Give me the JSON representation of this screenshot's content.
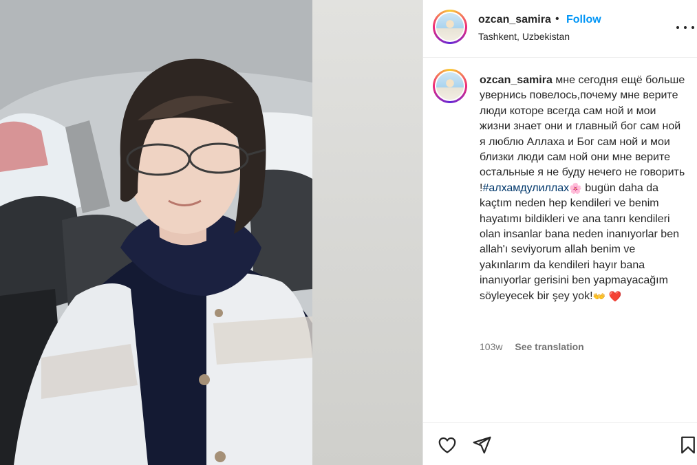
{
  "post": {
    "username": "ozcan_samira",
    "separator": "•",
    "follow_label": "Follow",
    "location": "Tashkent, Uzbekistan"
  },
  "caption": {
    "username": "ozcan_samira",
    "text_before_hashtag": "мне сегодня ещё больше увернись повелось,почему мне верите люди которе всегда сам ной и мои жизни знает они и главный бог сам ной я люблю Аллаха и Бог сам ной и мои близки люди сам ной они мне верите остальные я не буду нечего не говорить !",
    "hashtag": "#алхамдулиллах",
    "emoji_flower": "🌸",
    "text_after_hashtag": " bugün daha da kaçtım neden hep kendileri ve benim hayatımı bildikleri ve ana tanrı kendileri olan insanlar bana neden inanıyorlar ben allah'ı seviyorum allah benim ve yakınlarım da kendileri hayır bana inanıyorlar gerisini ben yapmayacağım söyleyecek bir şey yok!",
    "emoji_hands": "👐",
    "emoji_heart": "❤️"
  },
  "meta": {
    "time_ago": "103w",
    "see_translation_label": "See translation"
  },
  "icons": {
    "like": "heart-outline-icon",
    "share": "paper-plane-icon",
    "save": "bookmark-outline-icon",
    "more": "ellipsis-icon"
  },
  "colors": {
    "accent": "#0095f6",
    "hashtag": "#00376b",
    "text": "#262626",
    "secondary": "#737373"
  }
}
